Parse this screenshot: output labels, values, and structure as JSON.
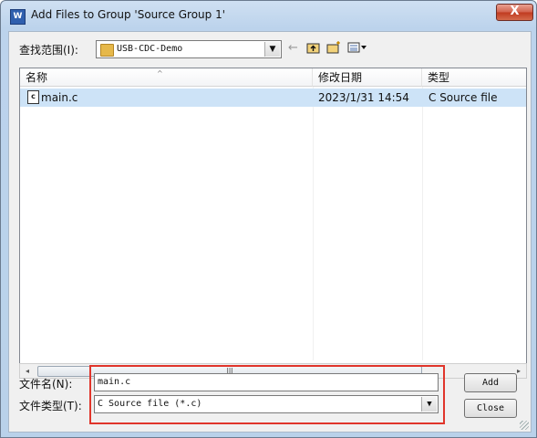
{
  "window": {
    "title": "Add Files to Group 'Source Group 1'",
    "close_glyph": "X"
  },
  "lookin": {
    "label": "查找范围(I):",
    "value": "USB-CDC-Demo"
  },
  "toolbar": {
    "back_glyph": "←",
    "up_glyph": "🖻",
    "newfolder_glyph": "✱",
    "view_glyph": "▦▾"
  },
  "filelist": {
    "columns": {
      "name": "名称",
      "modified": "修改日期",
      "type": "类型"
    },
    "rows": [
      {
        "name": "main.c",
        "modified": "2023/1/31 14:54",
        "type": "C Source file",
        "icon": "c"
      }
    ]
  },
  "scrollbar": {
    "left": "◂",
    "right": "▸",
    "thumb_grip": "III"
  },
  "filename": {
    "label": "文件名(N):",
    "value": "main.c"
  },
  "filetype": {
    "label": "文件类型(T):",
    "value": "C Source file (*.c)"
  },
  "buttons": {
    "add": "Add",
    "close": "Close"
  }
}
